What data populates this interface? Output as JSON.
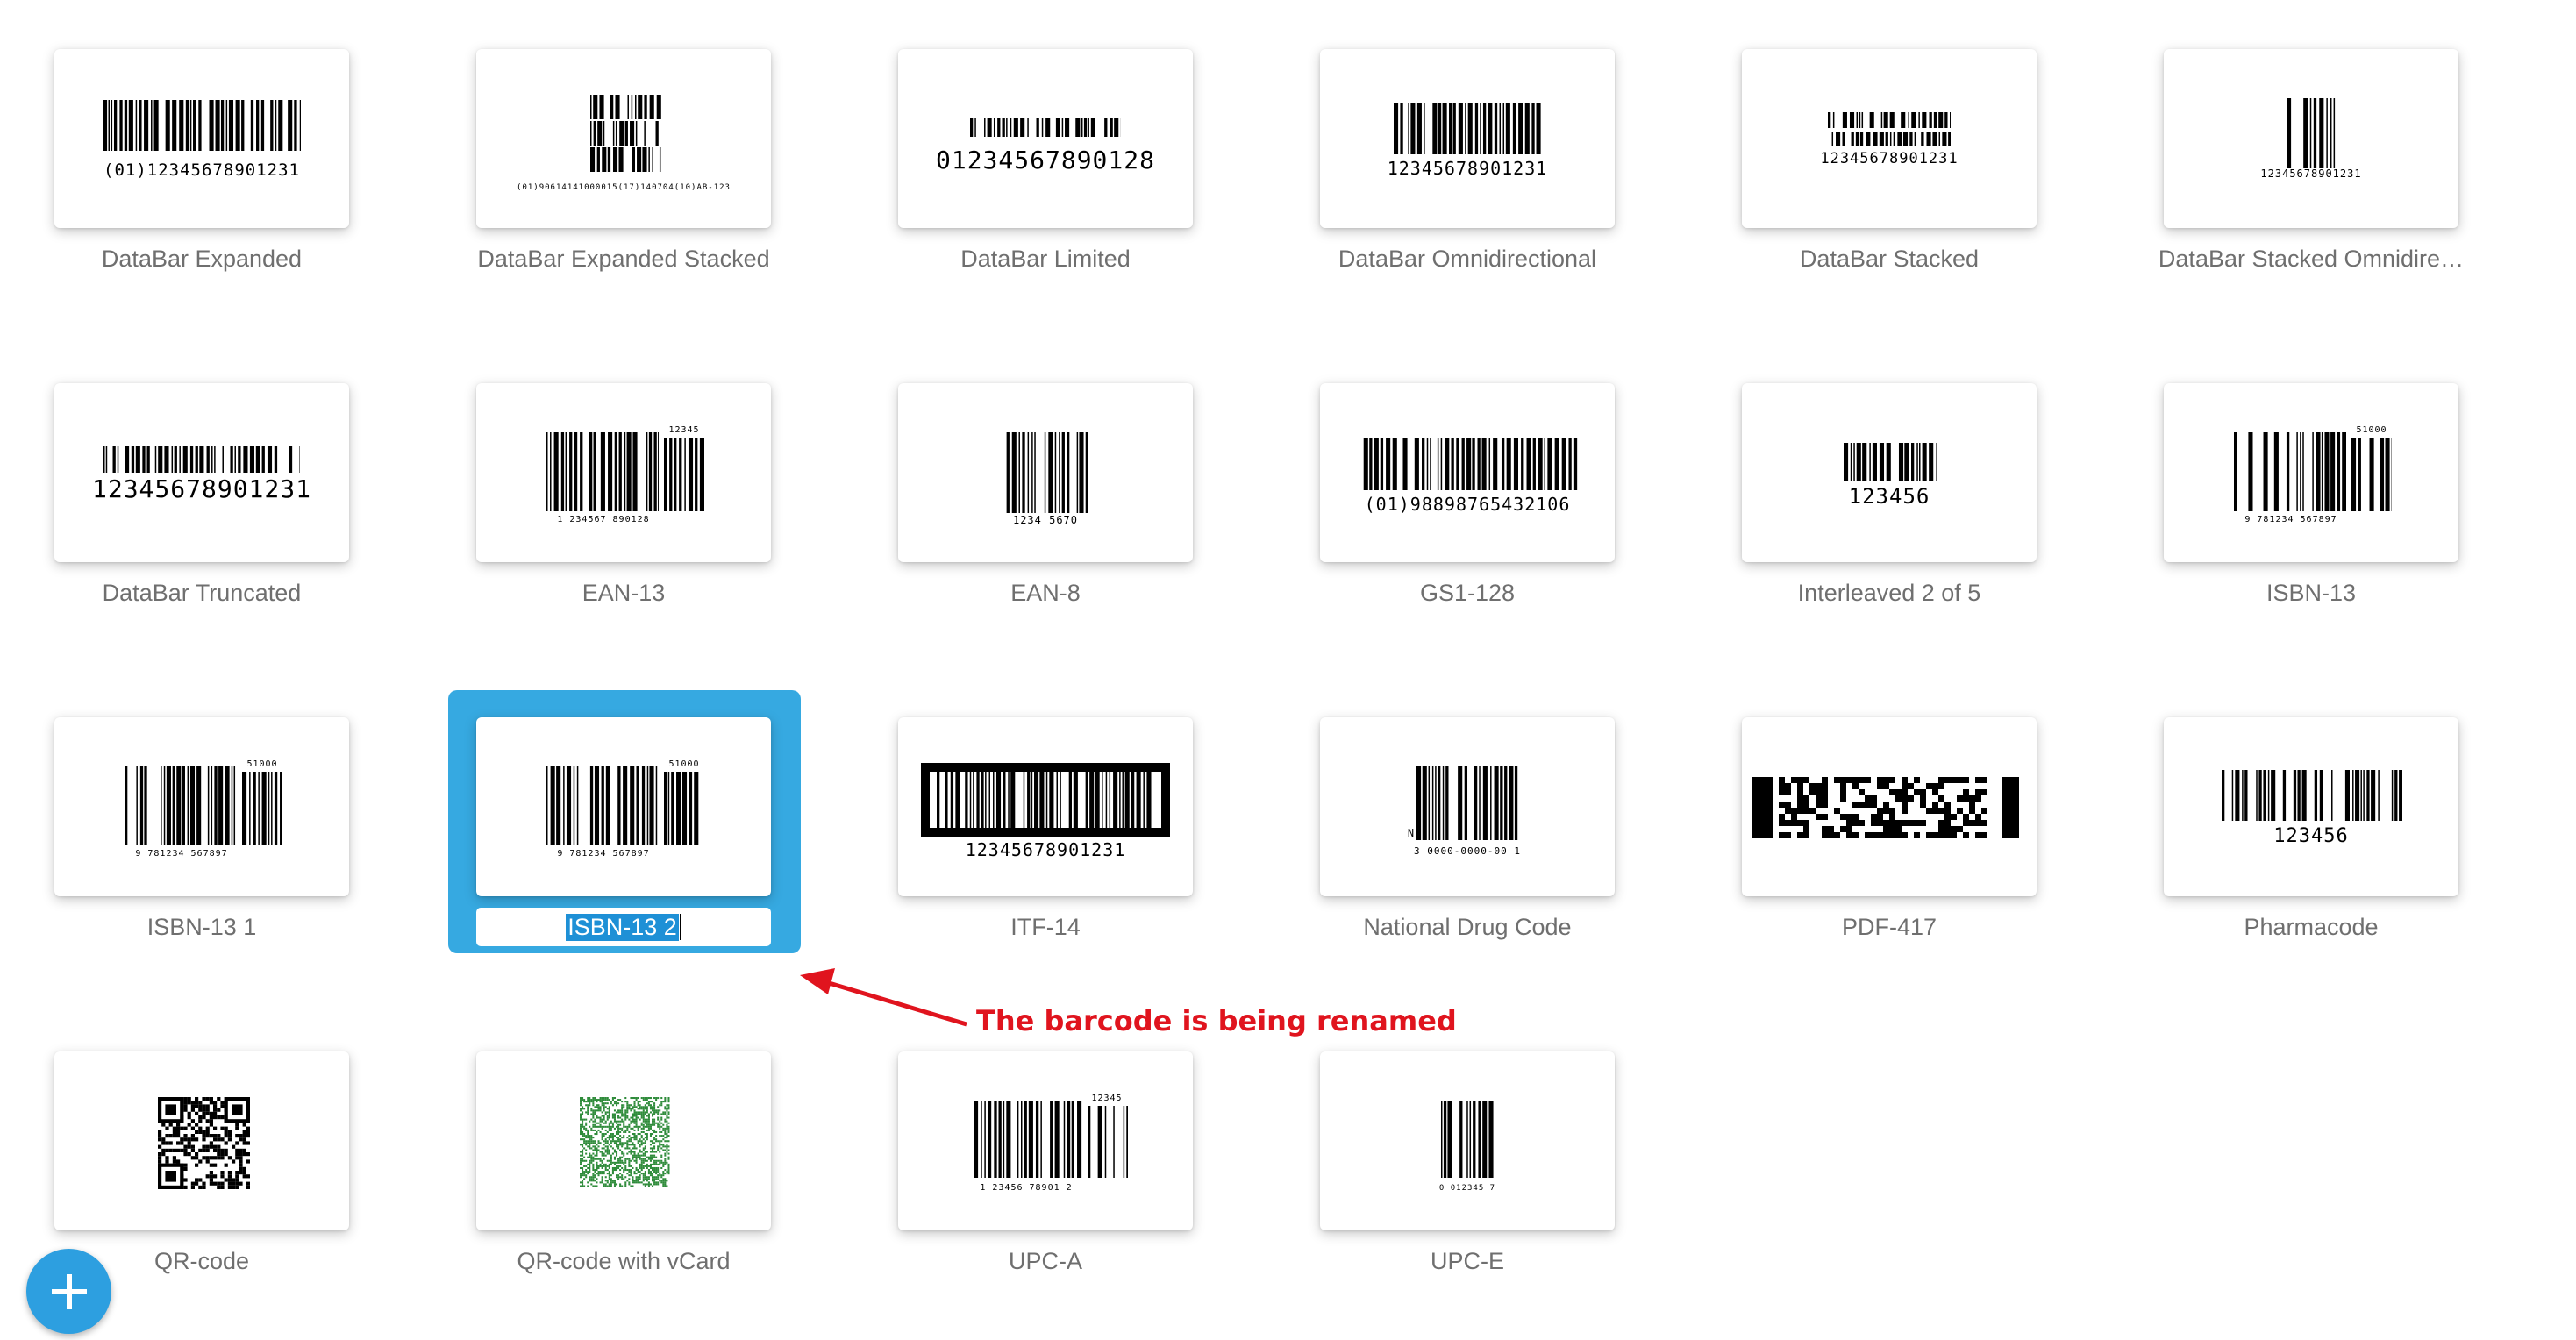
{
  "barcodes": [
    {
      "label": "DataBar Expanded",
      "human_text": "(01)12345678901231"
    },
    {
      "label": "DataBar Expanded Stacked",
      "human_text": "(01)90614141000015(17)140704(10)AB-123"
    },
    {
      "label": "DataBar Limited",
      "human_text": "01234567890128"
    },
    {
      "label": "DataBar Omnidirectional",
      "human_text": "12345678901231"
    },
    {
      "label": "DataBar Stacked",
      "human_text": "12345678901231"
    },
    {
      "label": "DataBar Stacked Omnidire…",
      "human_text": "12345678901231"
    },
    {
      "label": "DataBar Truncated",
      "human_text": "12345678901231"
    },
    {
      "label": "EAN-13",
      "human_text": "1 234567 890128",
      "addon": "12345"
    },
    {
      "label": "EAN-8",
      "human_text": "1234 5670"
    },
    {
      "label": "GS1-128",
      "human_text": "(01)98898765432106"
    },
    {
      "label": "Interleaved 2 of 5",
      "human_text": "123456"
    },
    {
      "label": "ISBN-13",
      "human_text": "9 781234 567897",
      "addon": "51000"
    },
    {
      "label": "ISBN-13 1",
      "human_text": "9 781234 567897",
      "addon": "51000"
    },
    {
      "label": "ISBN-13 2",
      "human_text": "9 781234 567897",
      "addon": "51000",
      "renaming": true
    },
    {
      "label": "ITF-14",
      "human_text": "12345678901231"
    },
    {
      "label": "National Drug Code",
      "human_text": "3 0000-0000-00 1",
      "prefix": "N"
    },
    {
      "label": "PDF-417",
      "human_text": ""
    },
    {
      "label": "Pharmacode",
      "human_text": "123456"
    },
    {
      "label": "QR-code",
      "human_text": ""
    },
    {
      "label": "QR-code with vCard",
      "human_text": ""
    },
    {
      "label": "UPC-A",
      "human_text": "1 23456 78901 2",
      "addon": "12345"
    },
    {
      "label": "UPC-E",
      "human_text": "0 012345 7"
    }
  ],
  "annotation": {
    "text": "The barcode is being renamed",
    "color": "#e0141e"
  },
  "colors": {
    "selection": "#36a9e1",
    "fab": "#2d9fe0",
    "label": "#6f6f6f",
    "qr_vcard": "#2e8b3a"
  },
  "fab": {
    "icon": "plus-icon"
  }
}
